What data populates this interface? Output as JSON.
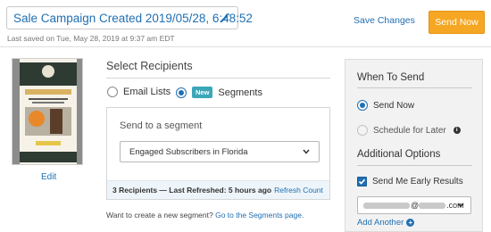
{
  "header": {
    "campaign_title": "Sale Campaign Created 2019/05/28, 6:48:52",
    "last_saved": "Last saved on Tue, May 28, 2019 at 9:37 am EDT",
    "save_changes_label": "Save Changes",
    "send_now_label": "Send Now",
    "send_now_color": "#f5a623"
  },
  "preview": {
    "edit_label": "Edit"
  },
  "recipients": {
    "title": "Select Recipients",
    "options": [
      {
        "label": "Email Lists",
        "selected": false
      },
      {
        "label": "Segments",
        "selected": true,
        "badge": "New"
      }
    ],
    "segment_box": {
      "label": "Send to a segment",
      "selected_segment": "Engaged Subscribers in Florida",
      "footer_count": "3 Recipients — Last Refreshed: 5 hours ago",
      "refresh_label": "Refresh Count"
    },
    "create_text": "Want to create a new segment?",
    "create_link": "Go to the Segments page."
  },
  "when_to_send": {
    "title": "When To Send",
    "options": [
      {
        "label": "Send Now",
        "selected": true
      },
      {
        "label": "Schedule for Later",
        "selected": false,
        "disabled": true
      }
    ]
  },
  "additional_options": {
    "title": "Additional Options",
    "early_results_label": "Send Me Early Results",
    "early_results_checked": true,
    "email_domain": "@",
    "email_suffix": ".com",
    "add_another_label": "Add Another"
  },
  "colors": {
    "link_blue": "#1f6fb2",
    "new_badge": "#3aa7b8"
  }
}
